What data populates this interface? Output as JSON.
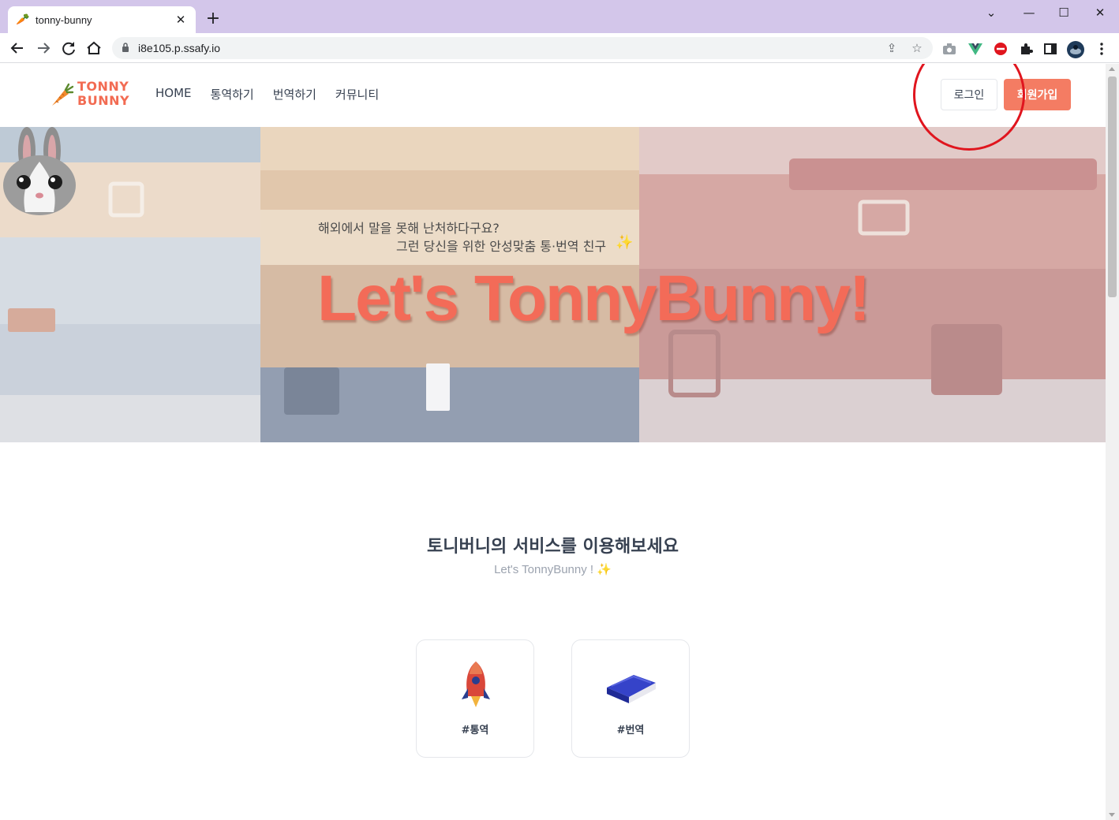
{
  "browser": {
    "tab_title": "tonny-bunny",
    "tab_close": "✕",
    "new_tab": "+",
    "url": "i8e105.p.ssafy.io",
    "window_controls": {
      "minimize": "—",
      "maximize": "☐",
      "close": "✕",
      "tab_list": "⌄"
    },
    "icons": [
      "back-icon",
      "forward-icon",
      "reload-icon",
      "home-icon",
      "lock-icon",
      "share-icon",
      "star-icon",
      "camera-icon",
      "vue-devtools-icon",
      "block-icon",
      "extensions-icon",
      "sidepanel-icon",
      "profile-avatar-icon",
      "menu-icon"
    ]
  },
  "site": {
    "logo_text": [
      "TONNY",
      "BUNNY"
    ],
    "nav": [
      "HOME",
      "통역하기",
      "번역하기",
      "커뮤니티"
    ],
    "login_label": "로그인",
    "signup_label": "회원가입",
    "accent_color": "#f47c63"
  },
  "hero": {
    "subtitle_line1": "해외에서 말을 못해 난처하다구요?",
    "subtitle_line2": "그런 당신을 위한 안성맞춤 통·번역 친구",
    "title": "Let's TonnyBunny!"
  },
  "services": {
    "title": "토니버니의 서비스를 이용해보세요",
    "subtitle": "Let's TonnyBunny !",
    "cards": [
      {
        "label": "#통역",
        "icon": "rocket-icon"
      },
      {
        "label": "#번역",
        "icon": "book-icon"
      }
    ]
  }
}
